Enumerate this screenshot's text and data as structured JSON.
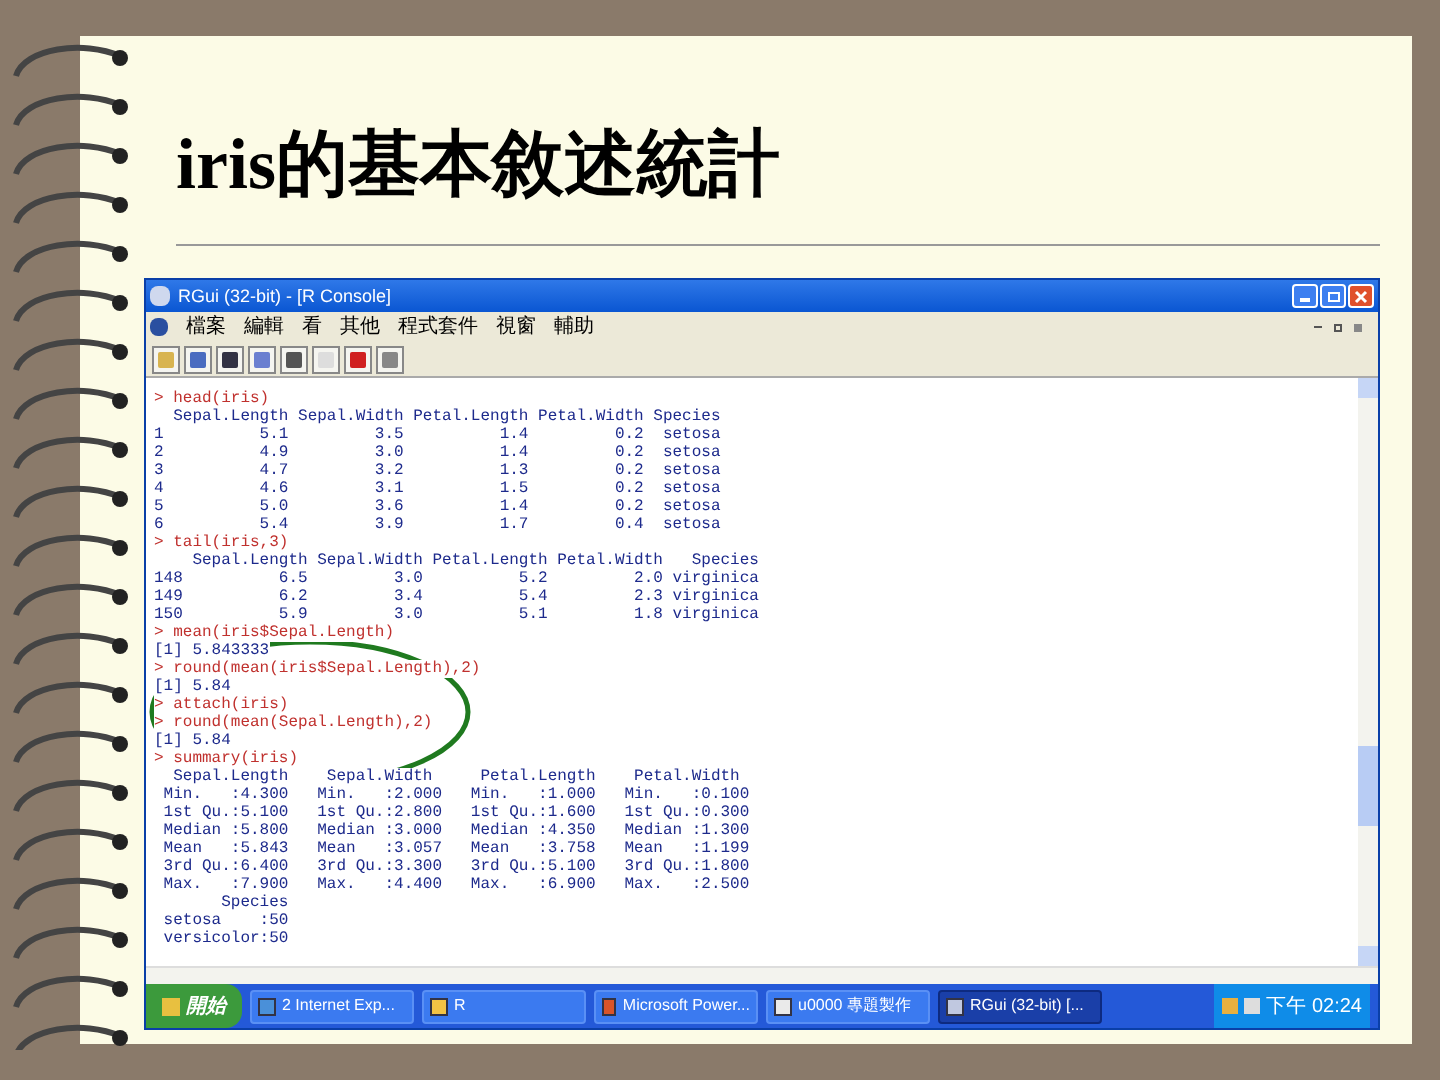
{
  "slide": {
    "title": "iris的基本敘述統計"
  },
  "window": {
    "title": "RGui (32-bit) - [R Console]",
    "menu": [
      "檔案",
      "編輯",
      "看",
      "其他",
      "程式套件",
      "視窗",
      "輔助"
    ]
  },
  "console": {
    "lines": [
      {
        "kind": "input",
        "text": "> head(iris)"
      },
      {
        "kind": "output",
        "text": "  Sepal.Length Sepal.Width Petal.Length Petal.Width Species"
      },
      {
        "kind": "output",
        "text": "1          5.1         3.5          1.4         0.2  setosa"
      },
      {
        "kind": "output",
        "text": "2          4.9         3.0          1.4         0.2  setosa"
      },
      {
        "kind": "output",
        "text": "3          4.7         3.2          1.3         0.2  setosa"
      },
      {
        "kind": "output",
        "text": "4          4.6         3.1          1.5         0.2  setosa"
      },
      {
        "kind": "output",
        "text": "5          5.0         3.6          1.4         0.2  setosa"
      },
      {
        "kind": "output",
        "text": "6          5.4         3.9          1.7         0.4  setosa"
      },
      {
        "kind": "input",
        "text": "> tail(iris,3)"
      },
      {
        "kind": "output",
        "text": "    Sepal.Length Sepal.Width Petal.Length Petal.Width   Species"
      },
      {
        "kind": "output",
        "text": "148          6.5         3.0          5.2         2.0 virginica"
      },
      {
        "kind": "output",
        "text": "149          6.2         3.4          5.4         2.3 virginica"
      },
      {
        "kind": "output",
        "text": "150          5.9         3.0          5.1         1.8 virginica"
      },
      {
        "kind": "input",
        "text": "> mean(iris$Sepal.Length)"
      },
      {
        "kind": "output",
        "text": "[1] 5.843333"
      },
      {
        "kind": "input",
        "text": "> round(mean(iris$Sepal.Length),2)"
      },
      {
        "kind": "output",
        "text": "[1] 5.84"
      },
      {
        "kind": "input",
        "text": "> attach(iris)"
      },
      {
        "kind": "input",
        "text": "> round(mean(Sepal.Length),2)"
      },
      {
        "kind": "output",
        "text": "[1] 5.84"
      },
      {
        "kind": "input",
        "text": "> summary(iris)"
      },
      {
        "kind": "output",
        "text": "  Sepal.Length    Sepal.Width     Petal.Length    Petal.Width   "
      },
      {
        "kind": "output",
        "text": " Min.   :4.300   Min.   :2.000   Min.   :1.000   Min.   :0.100  "
      },
      {
        "kind": "output",
        "text": " 1st Qu.:5.100   1st Qu.:2.800   1st Qu.:1.600   1st Qu.:0.300  "
      },
      {
        "kind": "output",
        "text": " Median :5.800   Median :3.000   Median :4.350   Median :1.300  "
      },
      {
        "kind": "output",
        "text": " Mean   :5.843   Mean   :3.057   Mean   :3.758   Mean   :1.199  "
      },
      {
        "kind": "output",
        "text": " 3rd Qu.:6.400   3rd Qu.:3.300   3rd Qu.:5.100   3rd Qu.:1.800  "
      },
      {
        "kind": "output",
        "text": " Max.   :7.900   Max.   :4.400   Max.   :6.900   Max.   :2.500  "
      },
      {
        "kind": "output",
        "text": "       Species  "
      },
      {
        "kind": "output",
        "text": " setosa    :50  "
      },
      {
        "kind": "output",
        "text": " versicolor:50  "
      }
    ]
  },
  "taskbar": {
    "start": "開始",
    "tasks": [
      {
        "label": "2 Internet Exp...",
        "selected": false
      },
      {
        "label": "R",
        "selected": false
      },
      {
        "label": "Microsoft Power...",
        "selected": false
      },
      {
        "label": "u0000 專題製作",
        "selected": false
      },
      {
        "label": "RGui (32-bit) [...",
        "selected": true
      }
    ],
    "clock": "下午 02:24"
  }
}
